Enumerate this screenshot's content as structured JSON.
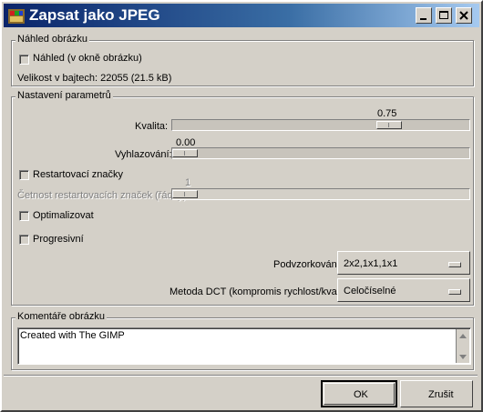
{
  "window": {
    "title": "Zapsat jako JPEG"
  },
  "preview": {
    "group_title": "Náhled obrázku",
    "checkbox_label": "Náhled (v okně obrázku)",
    "size_label": "Velikost v bajtech: 22055 (21.5 kB)"
  },
  "params": {
    "group_title": "Nastavení parametrů",
    "quality": {
      "label": "Kvalita:",
      "value": "0.75",
      "level": 0.75
    },
    "smoothing": {
      "label": "Vyhlazování:",
      "value": "0.00",
      "level": 0.0
    },
    "restart_markers": {
      "label": "Restartovací značky"
    },
    "restart_freq": {
      "label": "Četnost restartovacích značek (řádky):",
      "value": "1",
      "level": 0.0
    },
    "optimize": {
      "label": "Optimalizovat"
    },
    "progressive": {
      "label": "Progresivní"
    },
    "subsampling": {
      "label": "Podvzorkování:",
      "value": "2x2,1x1,1x1"
    },
    "dct": {
      "label": "Metoda DCT (kompromis rychlost/kvalita):",
      "value": "Celočíselné"
    }
  },
  "comments": {
    "group_title": "Komentáře obrázku",
    "text": "Created with The GIMP"
  },
  "buttons": {
    "ok": "OK",
    "cancel": "Zrušit"
  },
  "icons": {
    "app": "gimp-icon",
    "minimize": "minimize-icon",
    "maximize": "maximize-icon",
    "close": "close-icon"
  }
}
